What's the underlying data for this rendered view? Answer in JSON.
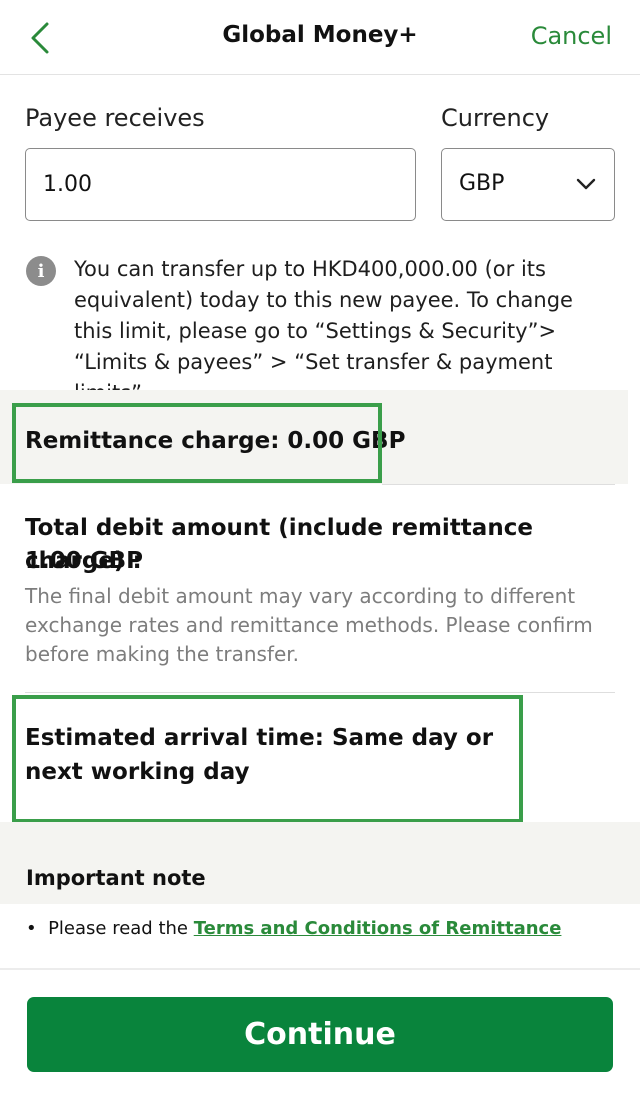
{
  "header": {
    "back_icon": "chevron-left-icon",
    "title": "Global Money+",
    "cancel_label": "Cancel"
  },
  "form": {
    "payee_receives_label": "Payee receives",
    "amount_value": "1.00",
    "currency_label": "Currency",
    "currency_value": "GBP",
    "currency_dropdown_icon": "chevron-down-icon"
  },
  "info": {
    "icon": "info-icon",
    "text": "You can transfer up to HKD400,000.00 (or its equivalent) today to this new payee. To change this limit, please go to “Settings & Security”> “Limits & payees” > “Set transfer & payment limits”."
  },
  "remittance": {
    "charge_text": "Remittance charge: 0.00 GBP"
  },
  "total": {
    "label": "Total debit amount (include remittance charge) :",
    "amount": "1.00 GBP",
    "note": "The final debit amount may vary according to different exchange rates and remittance methods. Please confirm before making the transfer."
  },
  "arrival": {
    "text": "Estimated arrival time: Same day or next working day"
  },
  "important": {
    "title": "Important note",
    "bullet_prefix": "Please read the ",
    "link_text": "Terms and Conditions of Remittance"
  },
  "continue_label": "Continue",
  "colors": {
    "brand_green": "#09843c",
    "highlight_green": "#3a9e4a",
    "link_green": "#2a8a3a"
  }
}
